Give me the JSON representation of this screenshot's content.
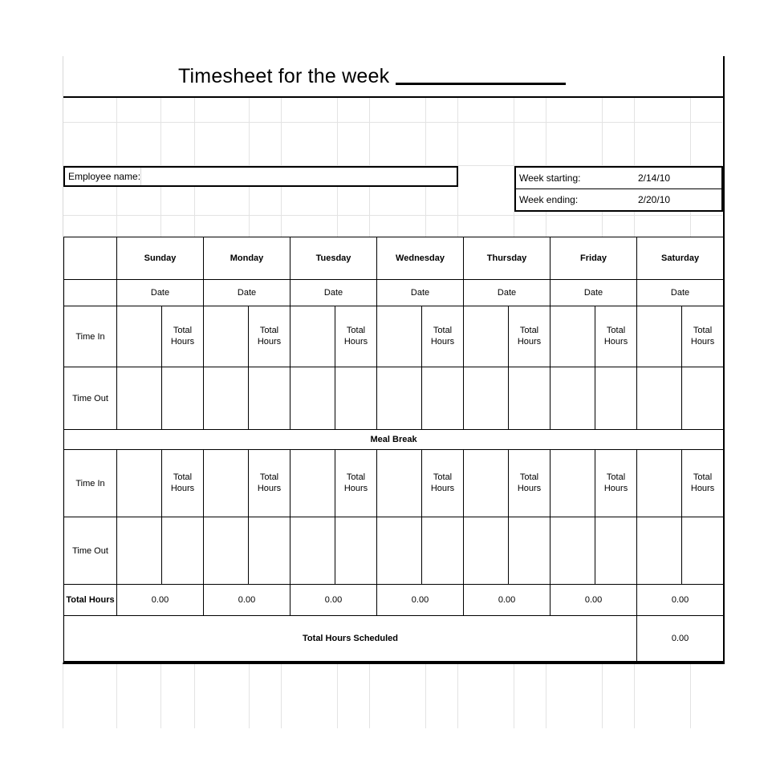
{
  "document": {
    "title_prefix": "Timesheet for the week",
    "title_blank_label": "blank-line"
  },
  "employee": {
    "name_label": "Employee name:",
    "name_value": ""
  },
  "week": {
    "starting_label": "Week starting:",
    "starting_value": "2/14/10",
    "ending_label": "Week ending:",
    "ending_value": "2/20/10"
  },
  "table": {
    "days": [
      "Sunday",
      "Monday",
      "Tuesday",
      "Wednesday",
      "Thursday",
      "Friday",
      "Saturday"
    ],
    "date_label": "Date",
    "total_hours_label": "Total\nHours",
    "total_hours_line1": "Total",
    "total_hours_line2": "Hours",
    "time_in_label": "Time In",
    "time_out_label": "Time Out",
    "meal_break_label": "Meal Break",
    "totals_row_label": "Total Hours",
    "daily_totals": [
      "0.00",
      "0.00",
      "0.00",
      "0.00",
      "0.00",
      "0.00",
      "0.00"
    ],
    "scheduled_label": "Total Hours Scheduled",
    "scheduled_value": "0.00"
  },
  "colors": {
    "header_green": "#ebf1da",
    "date_cream": "#fbf8ec",
    "total_gray": "#e8e8e8",
    "border_black": "#000000",
    "grid_gray": "#e3e3e3"
  }
}
